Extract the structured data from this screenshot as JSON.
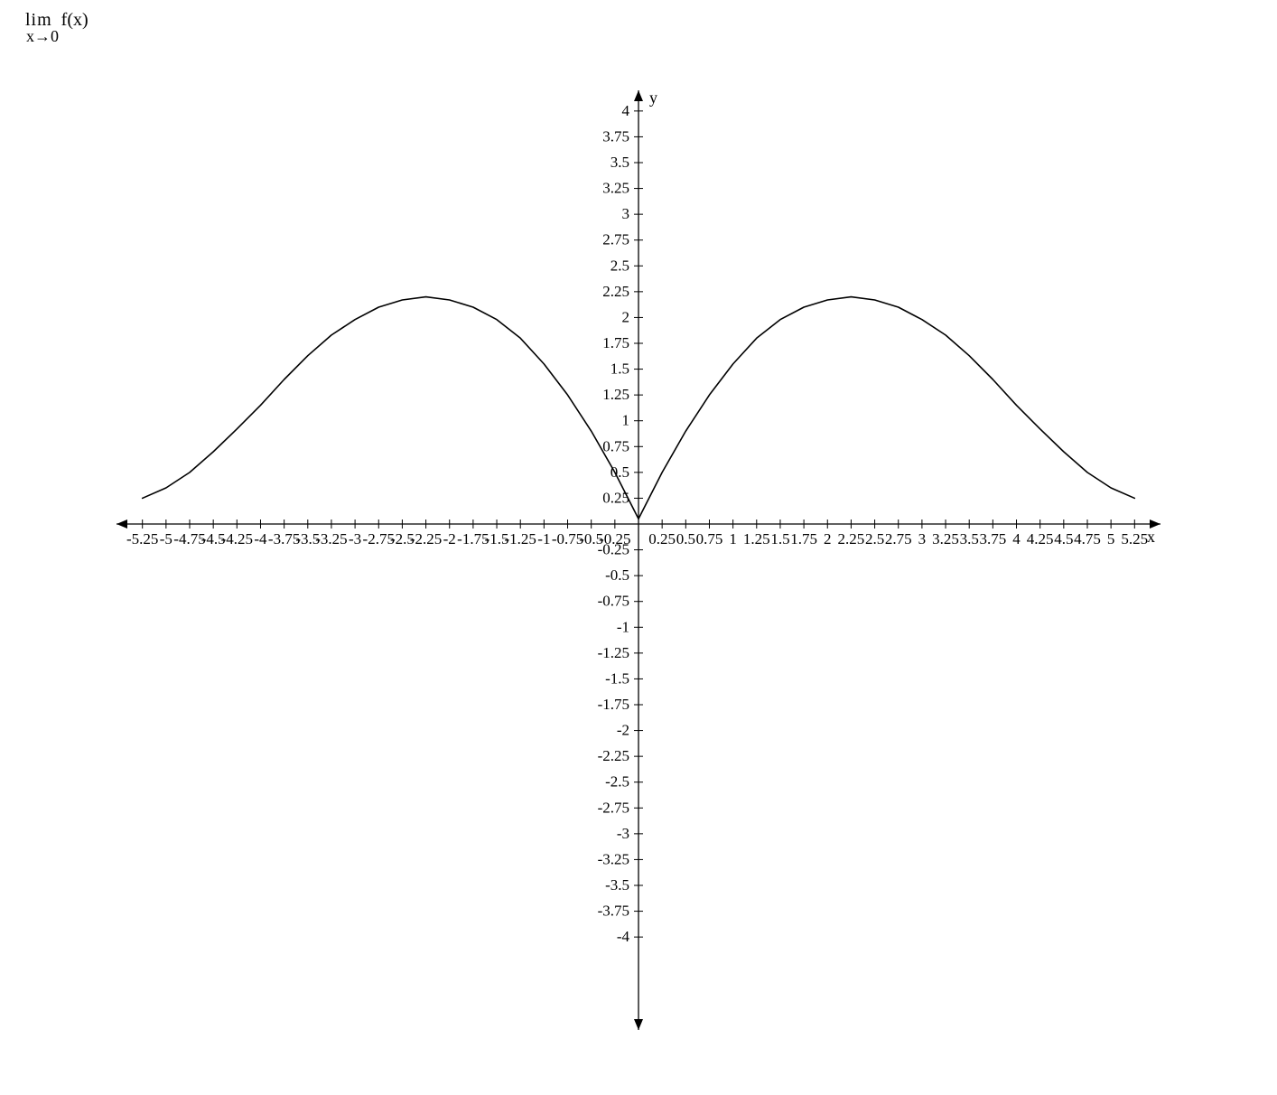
{
  "header": {
    "lim": "lim",
    "fx": "f(x)",
    "sub": "x→0"
  },
  "chart_data": {
    "type": "line",
    "xlabel": "x",
    "ylabel": "y",
    "xlim": [
      -5.4,
      5.4
    ],
    "ylim": [
      -4.2,
      4.2
    ],
    "x_ticks": [
      -5.25,
      -5,
      -4.75,
      -4.5,
      -4.25,
      -4,
      -3.75,
      -3.5,
      -3.25,
      -3,
      -2.75,
      -2.5,
      -2.25,
      -2,
      -1.75,
      -1.5,
      -1.25,
      -1,
      -0.75,
      -0.5,
      -0.25,
      0.25,
      0.5,
      0.75,
      1,
      1.25,
      1.5,
      1.75,
      2,
      2.25,
      2.5,
      2.75,
      3,
      3.25,
      3.5,
      3.75,
      4,
      4.25,
      4.5,
      4.75,
      5,
      5.25
    ],
    "y_ticks": [
      -4,
      -3.75,
      -3.5,
      -3.25,
      -3,
      -2.75,
      -2.5,
      -2.25,
      -2,
      -1.75,
      -1.5,
      -1.25,
      -1,
      -0.75,
      -0.5,
      -0.25,
      0.25,
      0.5,
      0.75,
      1,
      1.25,
      1.5,
      1.75,
      2,
      2.25,
      2.5,
      2.75,
      3,
      3.25,
      3.5,
      3.75,
      4
    ],
    "series": [
      {
        "name": "f(x)",
        "x": [
          -5.25,
          -5,
          -4.75,
          -4.5,
          -4.25,
          -4,
          -3.75,
          -3.5,
          -3.25,
          -3,
          -2.75,
          -2.5,
          -2.25,
          -2,
          -1.75,
          -1.5,
          -1.25,
          -1,
          -0.75,
          -0.5,
          -0.25,
          0,
          0.25,
          0.5,
          0.75,
          1,
          1.25,
          1.5,
          1.75,
          2,
          2.25,
          2.5,
          2.75,
          3,
          3.25,
          3.5,
          3.75,
          4,
          4.25,
          4.5,
          4.75,
          5,
          5.25
        ],
        "y": [
          0.25,
          0.35,
          0.5,
          0.7,
          0.92,
          1.15,
          1.4,
          1.63,
          1.83,
          1.98,
          2.1,
          2.17,
          2.2,
          2.17,
          2.1,
          1.98,
          1.8,
          1.55,
          1.25,
          0.9,
          0.5,
          0.05,
          0.5,
          0.9,
          1.25,
          1.55,
          1.8,
          1.98,
          2.1,
          2.17,
          2.2,
          2.17,
          2.1,
          1.98,
          1.83,
          1.63,
          1.4,
          1.15,
          0.92,
          0.7,
          0.5,
          0.35,
          0.25
        ]
      }
    ]
  }
}
